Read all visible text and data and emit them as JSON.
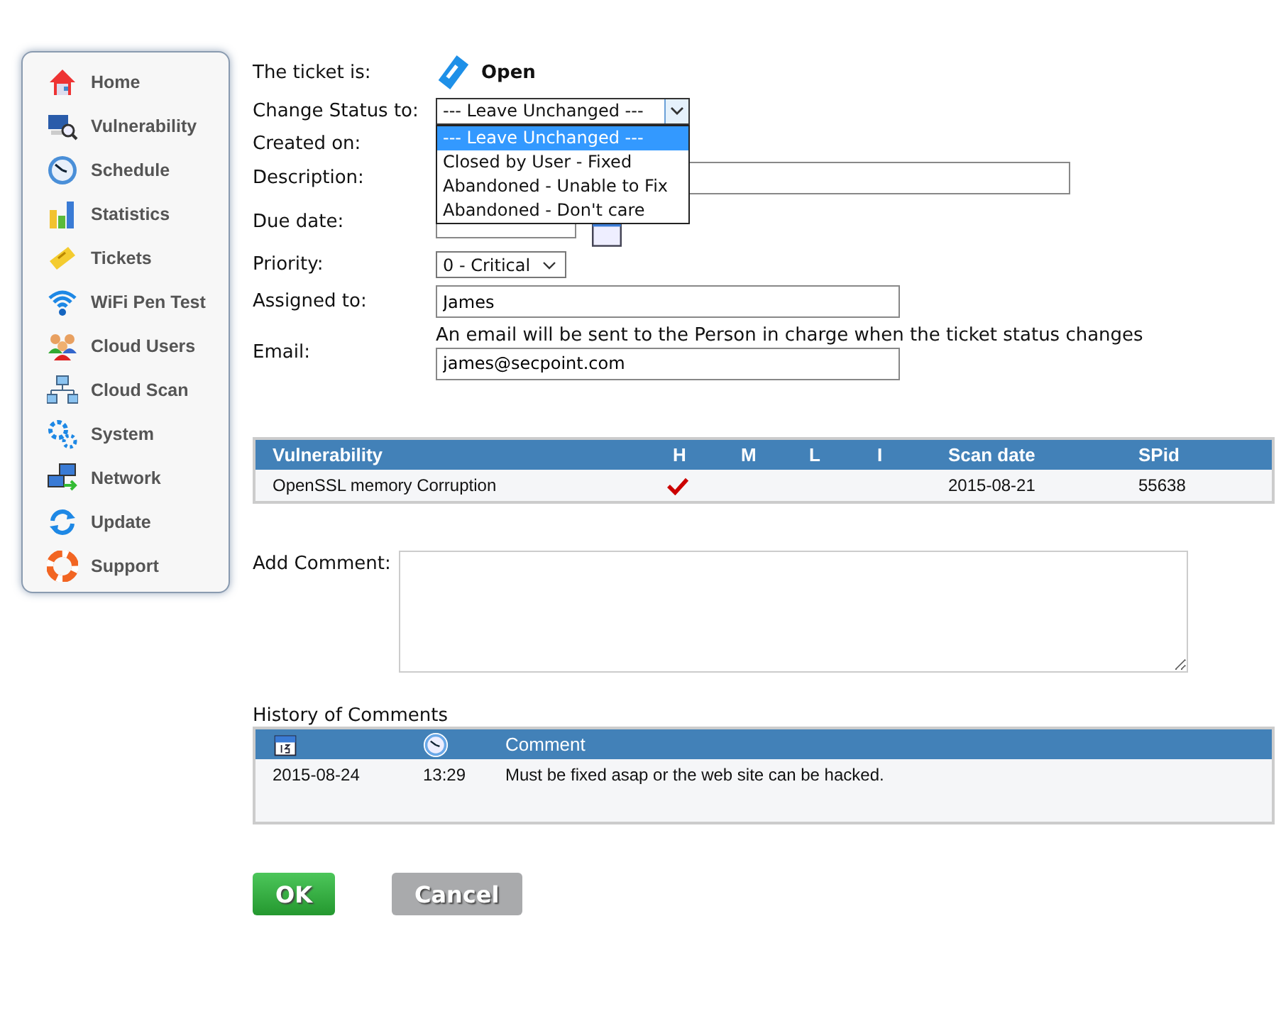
{
  "sidebar": {
    "items": [
      {
        "label": "Home"
      },
      {
        "label": "Vulnerability"
      },
      {
        "label": "Schedule"
      },
      {
        "label": "Statistics"
      },
      {
        "label": "Tickets"
      },
      {
        "label": "WiFi Pen Test"
      },
      {
        "label": "Cloud Users"
      },
      {
        "label": "Cloud Scan"
      },
      {
        "label": "System"
      },
      {
        "label": "Network"
      },
      {
        "label": "Update"
      },
      {
        "label": "Support"
      }
    ]
  },
  "form": {
    "ticket_status": {
      "label": "The ticket is:",
      "value": "Open"
    },
    "change_status": {
      "label": "Change Status to:",
      "value": "--- Leave Unchanged ---",
      "expanded": true,
      "options": [
        {
          "label": "--- Leave Unchanged ---",
          "selected": true
        },
        {
          "label": "Closed by User - Fixed",
          "selected": false
        },
        {
          "label": "Abandoned - Unable to Fix",
          "selected": false
        },
        {
          "label": "Abandoned - Don't care",
          "selected": false
        }
      ]
    },
    "created_on": {
      "label": "Created on:"
    },
    "description": {
      "label": "Description:"
    },
    "due_date": {
      "label": "Due date:"
    },
    "priority": {
      "label": "Priority:",
      "value": "0 - Critical"
    },
    "assigned_to": {
      "label": "Assigned to:",
      "value": "James"
    },
    "email": {
      "label": "Email:",
      "note": "An email will be sent to the Person in charge when the ticket status changes",
      "value": "james@secpoint.com"
    }
  },
  "vulnerabilities": {
    "columns": [
      "Vulnerability",
      "H",
      "M",
      "L",
      "I",
      "Scan date",
      "SPid"
    ],
    "rows": [
      {
        "vulnerability": "OpenSSL memory Corruption",
        "h": true,
        "m": false,
        "l": false,
        "i": false,
        "scan_date": "2015-08-21",
        "spid": "55638"
      }
    ]
  },
  "add_comment": {
    "label": "Add Comment:"
  },
  "history": {
    "title": "History of Comments",
    "columns": [
      {
        "kind": "calendar"
      },
      {
        "kind": "clock"
      },
      {
        "kind": "text",
        "label": "Comment"
      }
    ],
    "rows": [
      {
        "date": "2015-08-24",
        "time": "13:29",
        "comment": "Must be fixed asap or the web site can be hacked."
      }
    ]
  },
  "buttons": [
    {
      "label": "OK",
      "kind": "primary"
    },
    {
      "label": "Cancel",
      "kind": "secondary"
    }
  ]
}
